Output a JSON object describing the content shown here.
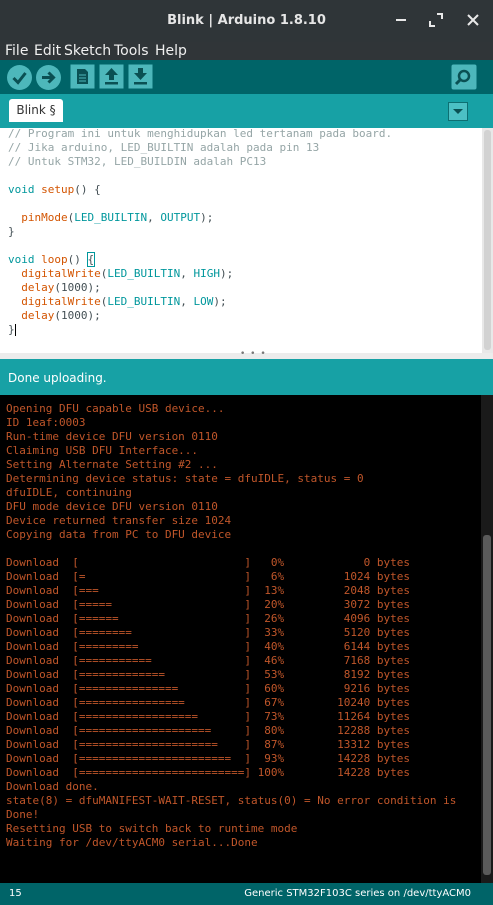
{
  "window": {
    "title": "Blink | Arduino 1.8.10"
  },
  "menu": [
    "File",
    "Edit",
    "Sketch",
    "Tools",
    "Help"
  ],
  "toolbar": {
    "verify": "check-icon",
    "upload": "arrow-right-icon",
    "new": "document-icon",
    "open": "arrow-up-icon",
    "save": "arrow-down-icon",
    "serial_monitor": "magnifier-icon"
  },
  "tab": {
    "label": "Blink §"
  },
  "editor": {
    "lines": [
      [
        {
          "t": "// Program ini untuk menghidupkan led tertanam pada board.",
          "c": "comment"
        }
      ],
      [
        {
          "t": "// Jika arduino, LED_BUILTIN adalah pada pin 13",
          "c": "comment"
        }
      ],
      [
        {
          "t": "// Untuk STM32, LED_BUILDIN adalah PC13",
          "c": "comment"
        }
      ],
      [],
      [
        {
          "t": "void",
          "c": "kw"
        },
        {
          "t": " "
        },
        {
          "t": "setup",
          "c": "fn"
        },
        {
          "t": "() {"
        }
      ],
      [],
      [
        {
          "t": "  "
        },
        {
          "t": "pinMode",
          "c": "fn"
        },
        {
          "t": "("
        },
        {
          "t": "LED_BUILTIN",
          "c": "kw"
        },
        {
          "t": ", "
        },
        {
          "t": "OUTPUT",
          "c": "kw"
        },
        {
          "t": ");"
        }
      ],
      [
        {
          "t": "}"
        }
      ],
      [],
      [
        {
          "t": "void",
          "c": "kw"
        },
        {
          "t": " "
        },
        {
          "t": "loop",
          "c": "fn"
        },
        {
          "t": "() "
        },
        {
          "t": "{",
          "c": "br"
        }
      ],
      [
        {
          "t": "  "
        },
        {
          "t": "digitalWrite",
          "c": "fn"
        },
        {
          "t": "("
        },
        {
          "t": "LED_BUILTIN",
          "c": "kw"
        },
        {
          "t": ", "
        },
        {
          "t": "HIGH",
          "c": "kw"
        },
        {
          "t": ");"
        }
      ],
      [
        {
          "t": "  "
        },
        {
          "t": "delay",
          "c": "fn"
        },
        {
          "t": "(1000);"
        }
      ],
      [
        {
          "t": "  "
        },
        {
          "t": "digitalWrite",
          "c": "fn"
        },
        {
          "t": "("
        },
        {
          "t": "LED_BUILTIN",
          "c": "kw"
        },
        {
          "t": ", "
        },
        {
          "t": "LOW",
          "c": "kw"
        },
        {
          "t": ");"
        }
      ],
      [
        {
          "t": "  "
        },
        {
          "t": "delay",
          "c": "fn"
        },
        {
          "t": "(1000);"
        }
      ],
      [
        {
          "t": "}"
        },
        {
          "t": "",
          "c": "cursor"
        }
      ]
    ]
  },
  "status": {
    "message": "Done uploading."
  },
  "console": {
    "lines": [
      "Opening DFU capable USB device...",
      "ID 1eaf:0003",
      "Run-time device DFU version 0110",
      "Claiming USB DFU Interface...",
      "Setting Alternate Setting #2 ...",
      "Determining device status: state = dfuIDLE, status = 0",
      "dfuIDLE, continuing",
      "DFU mode device DFU version 0110",
      "Device returned transfer size 1024",
      "Copying data from PC to DFU device",
      "",
      "Download  [                         ]   0%            0 bytes",
      "Download  [=                        ]   6%         1024 bytes",
      "Download  [===                      ]  13%         2048 bytes",
      "Download  [=====                    ]  20%         3072 bytes",
      "Download  [======                   ]  26%         4096 bytes",
      "Download  [========                 ]  33%         5120 bytes",
      "Download  [=========                ]  40%         6144 bytes",
      "Download  [===========              ]  46%         7168 bytes",
      "Download  [=============            ]  53%         8192 bytes",
      "Download  [===============          ]  60%         9216 bytes",
      "Download  [================         ]  67%        10240 bytes",
      "Download  [==================       ]  73%        11264 bytes",
      "Download  [====================     ]  80%        12288 bytes",
      "Download  [=====================    ]  87%        13312 bytes",
      "Download  [=======================  ]  93%        14228 bytes",
      "Download  [=========================] 100%        14228 bytes",
      "Download done.",
      "state(8) = dfuMANIFEST-WAIT-RESET, status(0) = No error condition is",
      "Done!",
      "Resetting USB to switch back to runtime mode",
      "Waiting for /dev/ttyACM0 serial...Done"
    ]
  },
  "bottom": {
    "line_number": "15",
    "board": "Generic STM32F103C series on /dev/ttyACM0"
  }
}
